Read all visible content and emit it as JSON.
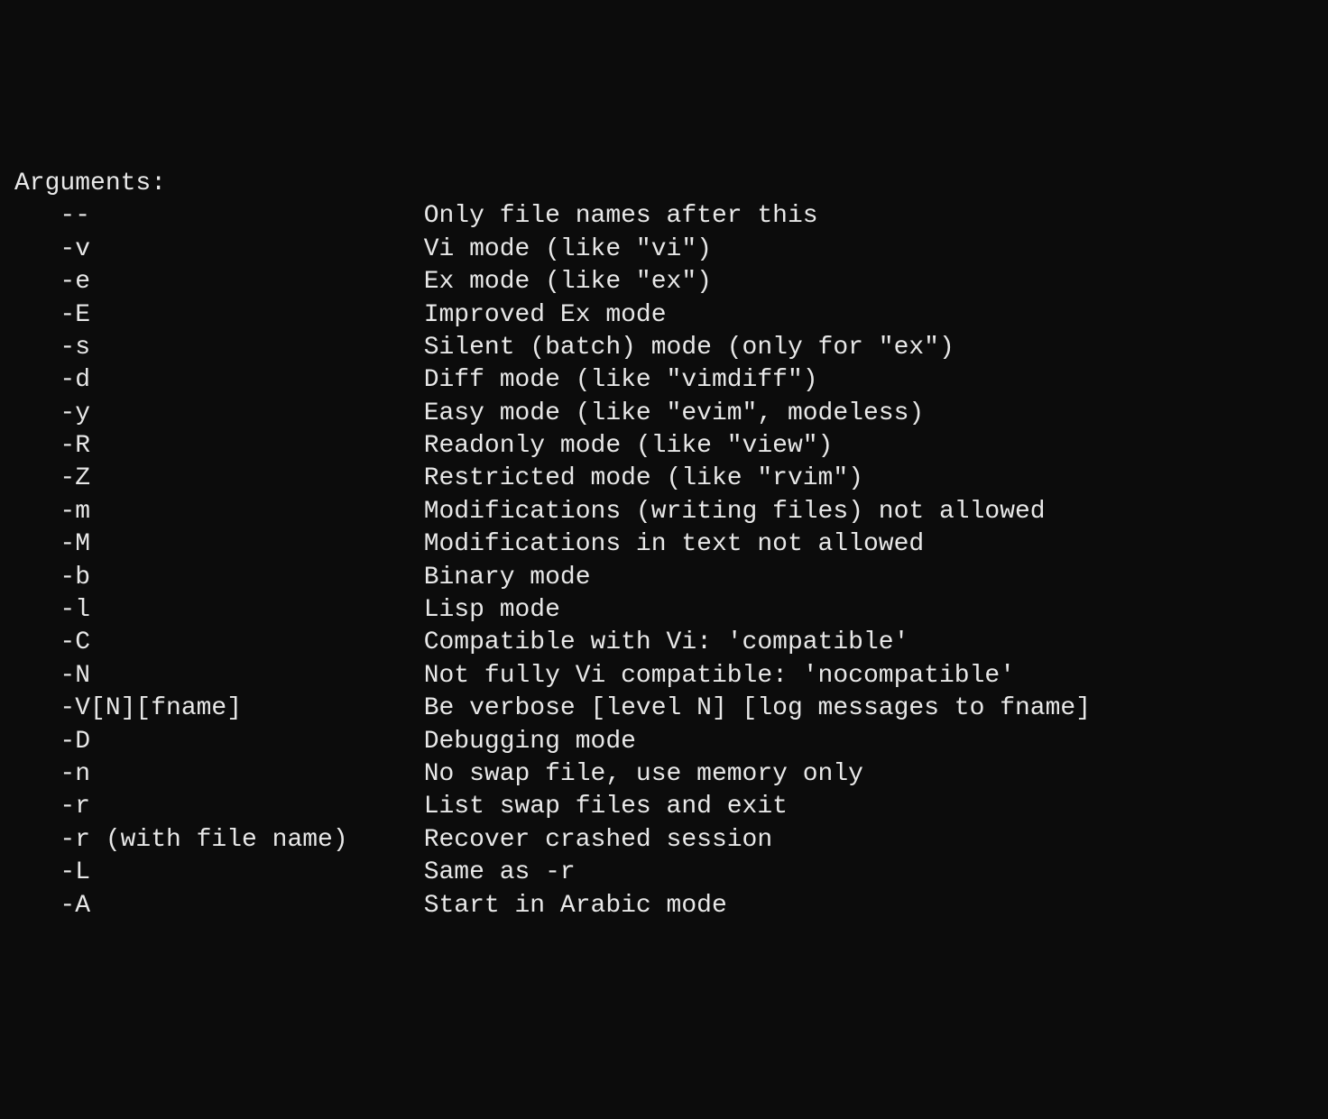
{
  "header": "Arguments:",
  "arguments": [
    {
      "flag": "--",
      "description": "Only file names after this"
    },
    {
      "flag": "-v",
      "description": "Vi mode (like \"vi\")"
    },
    {
      "flag": "-e",
      "description": "Ex mode (like \"ex\")"
    },
    {
      "flag": "-E",
      "description": "Improved Ex mode"
    },
    {
      "flag": "-s",
      "description": "Silent (batch) mode (only for \"ex\")"
    },
    {
      "flag": "-d",
      "description": "Diff mode (like \"vimdiff\")"
    },
    {
      "flag": "-y",
      "description": "Easy mode (like \"evim\", modeless)"
    },
    {
      "flag": "-R",
      "description": "Readonly mode (like \"view\")"
    },
    {
      "flag": "-Z",
      "description": "Restricted mode (like \"rvim\")"
    },
    {
      "flag": "-m",
      "description": "Modifications (writing files) not allowed"
    },
    {
      "flag": "-M",
      "description": "Modifications in text not allowed"
    },
    {
      "flag": "-b",
      "description": "Binary mode"
    },
    {
      "flag": "-l",
      "description": "Lisp mode"
    },
    {
      "flag": "-C",
      "description": "Compatible with Vi: 'compatible'"
    },
    {
      "flag": "-N",
      "description": "Not fully Vi compatible: 'nocompatible'"
    },
    {
      "flag": "-V[N][fname]",
      "description": "Be verbose [level N] [log messages to fname]"
    },
    {
      "flag": "-D",
      "description": "Debugging mode"
    },
    {
      "flag": "-n",
      "description": "No swap file, use memory only"
    },
    {
      "flag": "-r",
      "description": "List swap files and exit"
    },
    {
      "flag": "-r (with file name)",
      "description": "Recover crashed session"
    },
    {
      "flag": "-L",
      "description": "Same as -r"
    },
    {
      "flag": "-A",
      "description": "Start in Arabic mode"
    }
  ],
  "layout": {
    "indent": "   ",
    "flag_width": 24
  }
}
